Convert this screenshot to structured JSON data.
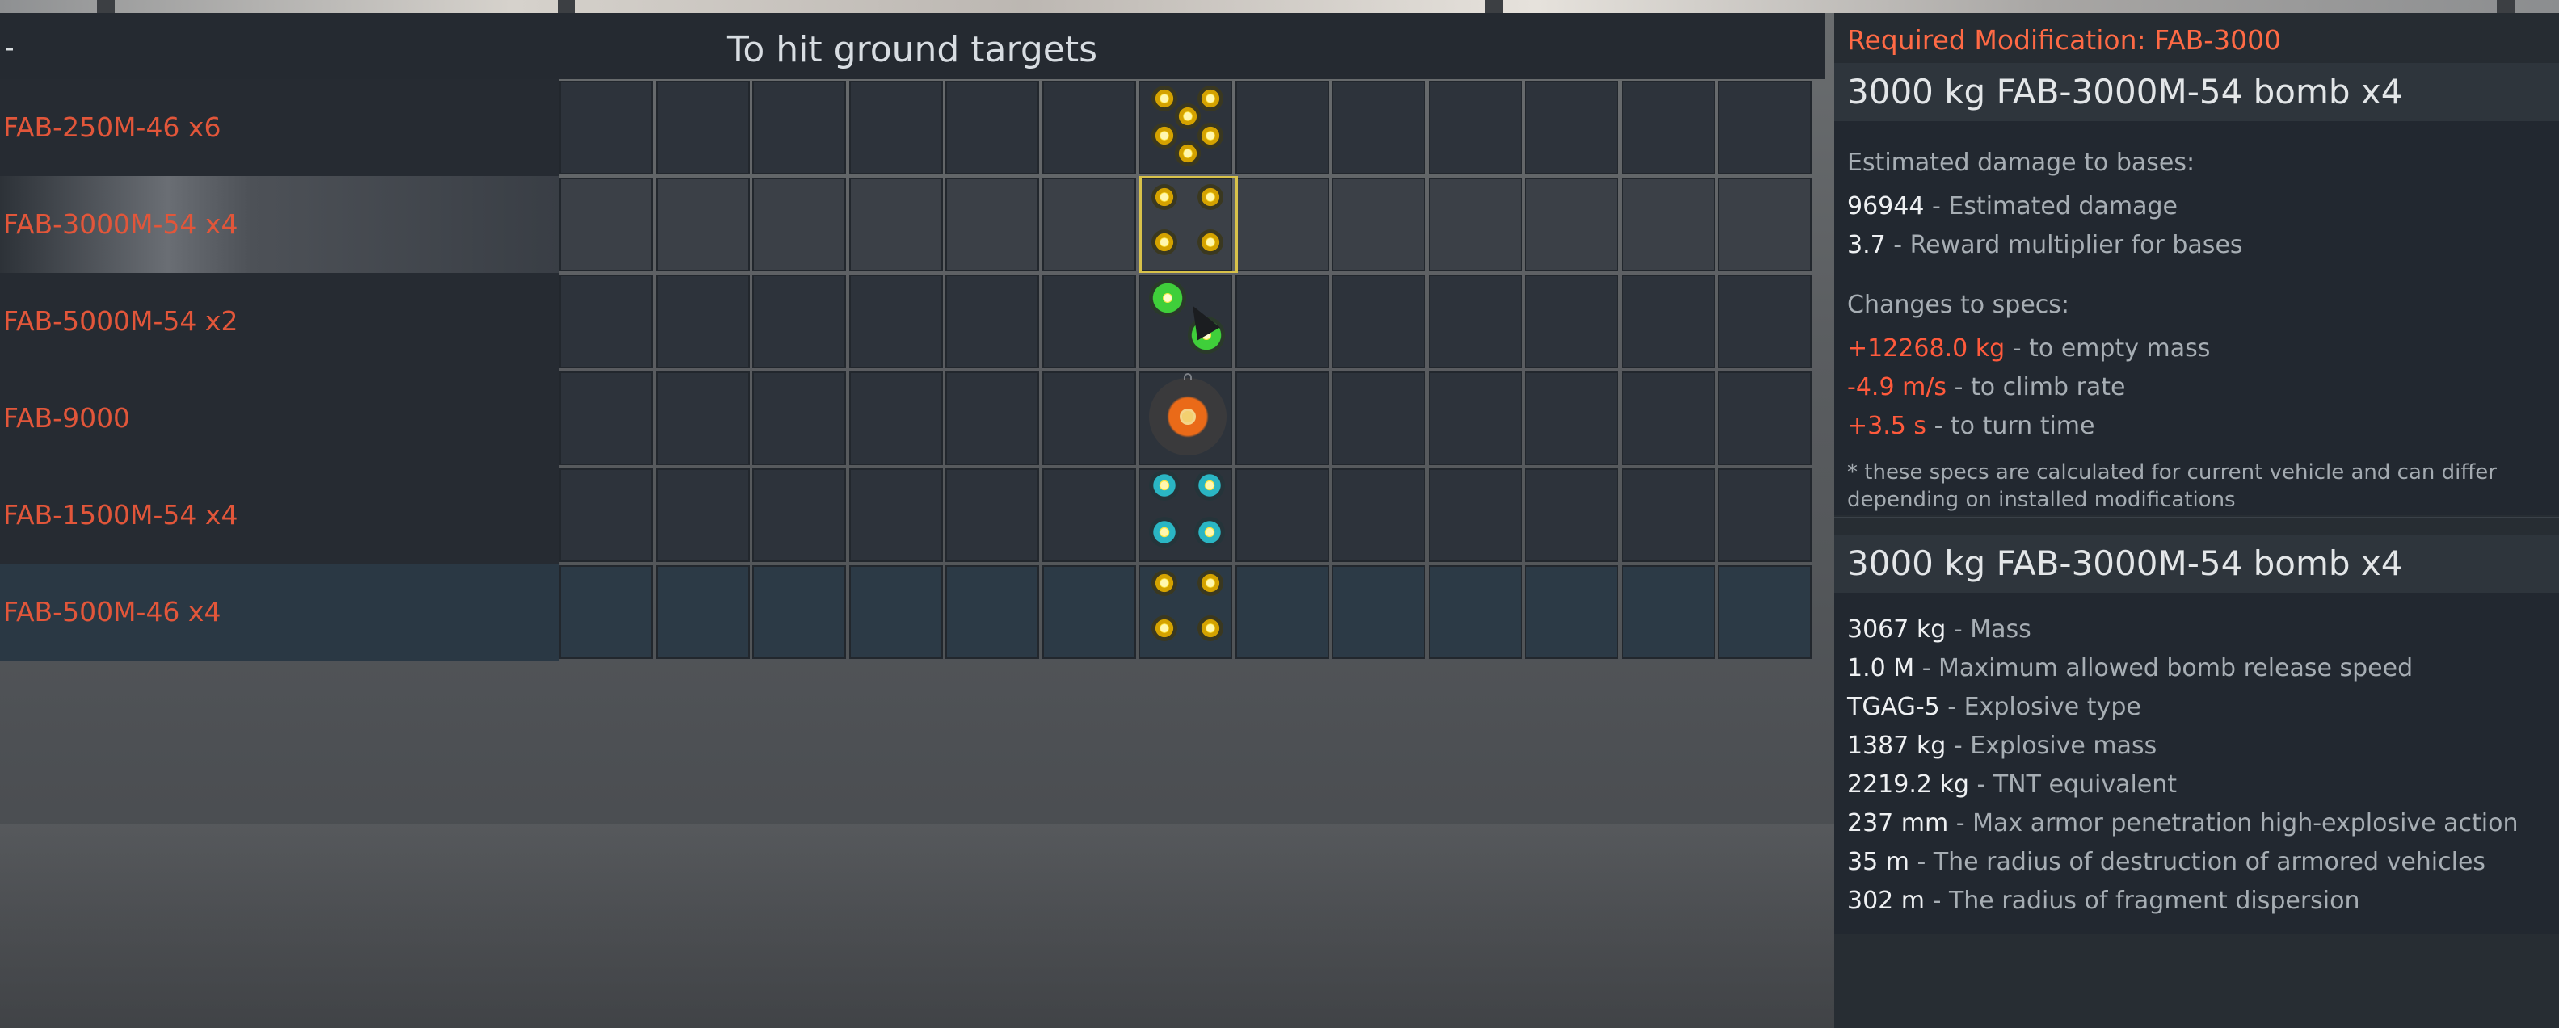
{
  "header": {
    "dash": "-",
    "title": "To hit ground targets"
  },
  "rows": [
    {
      "label": "FAB-250M-46 x6",
      "state": "normal"
    },
    {
      "label": "FAB-3000M-54 x4",
      "state": "selected"
    },
    {
      "label": "FAB-5000M-54 x2",
      "state": "normal"
    },
    {
      "label": "FAB-9000",
      "state": "normal"
    },
    {
      "label": "FAB-1500M-54 x4",
      "state": "normal"
    },
    {
      "label": "FAB-500M-46 x4",
      "state": "hover"
    }
  ],
  "sidepanel": {
    "required_modification": "Required Modification: FAB-3000",
    "damage_panel": {
      "title": "3000 kg FAB-3000M-54 bomb x4",
      "bases_heading": "Estimated damage to bases:",
      "estimated_damage": {
        "value": "96944",
        "label": "- Estimated damage"
      },
      "reward_multiplier": {
        "value": "3.7",
        "label": "- Reward multiplier for bases"
      },
      "specs_heading": "Changes to specs:",
      "empty_mass": {
        "value": "+12268.0 kg",
        "label": "- to empty mass"
      },
      "climb_rate": {
        "value": "-4.9 m/s",
        "label": "- to climb rate"
      },
      "turn_time": {
        "value": "+3.5 s",
        "label": "- to turn time"
      },
      "note": "* these specs are calculated for current vehicle and can differ depending on installed modifications"
    },
    "bomb_panel": {
      "title": "3000 kg FAB-3000M-54 bomb x4",
      "specs": [
        {
          "value": "3067 kg",
          "label": "- Mass"
        },
        {
          "value": "1.0 M",
          "label": "- Maximum allowed bomb release speed"
        },
        {
          "value": "TGAG-5",
          "label": "- Explosive type"
        },
        {
          "value": "1387 kg",
          "label": "- Explosive mass"
        },
        {
          "value": "2219.2 kg",
          "label": "- TNT equivalent"
        },
        {
          "value": "237 mm",
          "label": "- Max armor penetration high-explosive action"
        },
        {
          "value": "35 m",
          "label": "- The radius of destruction of armored vehicles"
        },
        {
          "value": "302 m",
          "label": "- The radius of fragment dispersion"
        }
      ]
    }
  },
  "colors": {
    "accent_red": "#e2563a",
    "selection_gold": "#d8c24a",
    "panel_bg": "#222830"
  },
  "icons": [
    "bomb-icon-yellow",
    "bomb-icon-green",
    "bomb-icon-cyan",
    "bomb-icon-orange",
    "mouse-cursor-icon"
  ]
}
